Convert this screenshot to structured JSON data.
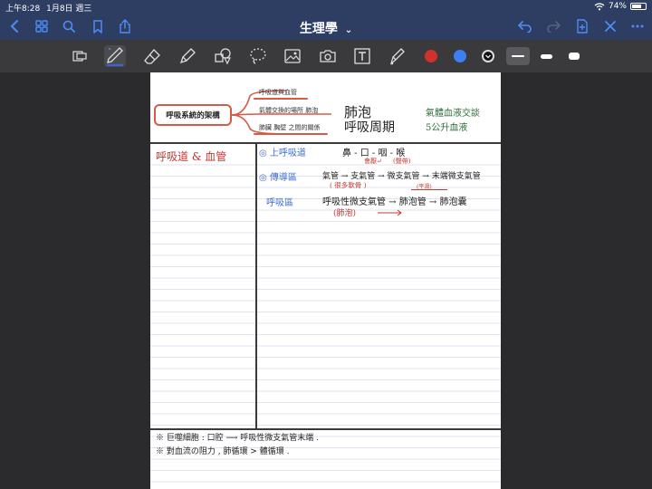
{
  "status": {
    "time": "上午8:28",
    "date": "1月8日 週三",
    "battery": "74%",
    "battery_level": 0.74
  },
  "nav": {
    "title": "生理學",
    "title_chevron": "⌄"
  },
  "colors": {
    "nav_bg": "#2e3e63",
    "toolbar_bg": "#3a3a3c",
    "swatch_red": "#d0312d",
    "swatch_blue": "#3b7ff2",
    "swatch_black": "#111111",
    "accent_red": "#d65a46"
  },
  "mindmap": {
    "root": "呼吸系統的架構",
    "branches": [
      "呼吸道與血管",
      "氣體交換的場所 肺泡",
      "肺臟 胸壁 之間的關係"
    ]
  },
  "notes": {
    "top_right": {
      "alveoli": "肺泡",
      "resp_cycle": "呼吸周期",
      "gas_exchange": "氣體血液交談",
      "five_liters": "5公升血液"
    },
    "left_title": "呼吸道 & 血管",
    "row1": {
      "label": "◎ 上呼吸道",
      "content": "鼻 - 口 - 咽 - 喉",
      "note1": "會厭↵",
      "note2": "(聲帶)"
    },
    "row2": {
      "label": "◎ 傳導區",
      "content": "氣管 → 支氣管 → 微支氣管 → 末端微支氣管",
      "note": "( 很多軟骨 )",
      "note2": "(平滑)"
    },
    "row3": {
      "label": "呼吸區",
      "content": "呼吸性微支氣管 → 肺泡管 → 肺泡囊",
      "note": "(肺泡)"
    },
    "bottom1": "※ 巨噬細胞 : 口腔 ⟶ 呼吸性微支氣管末端 .",
    "bottom2": "※ 對血流の阻力 , 肺循環 > 體循環 ."
  }
}
